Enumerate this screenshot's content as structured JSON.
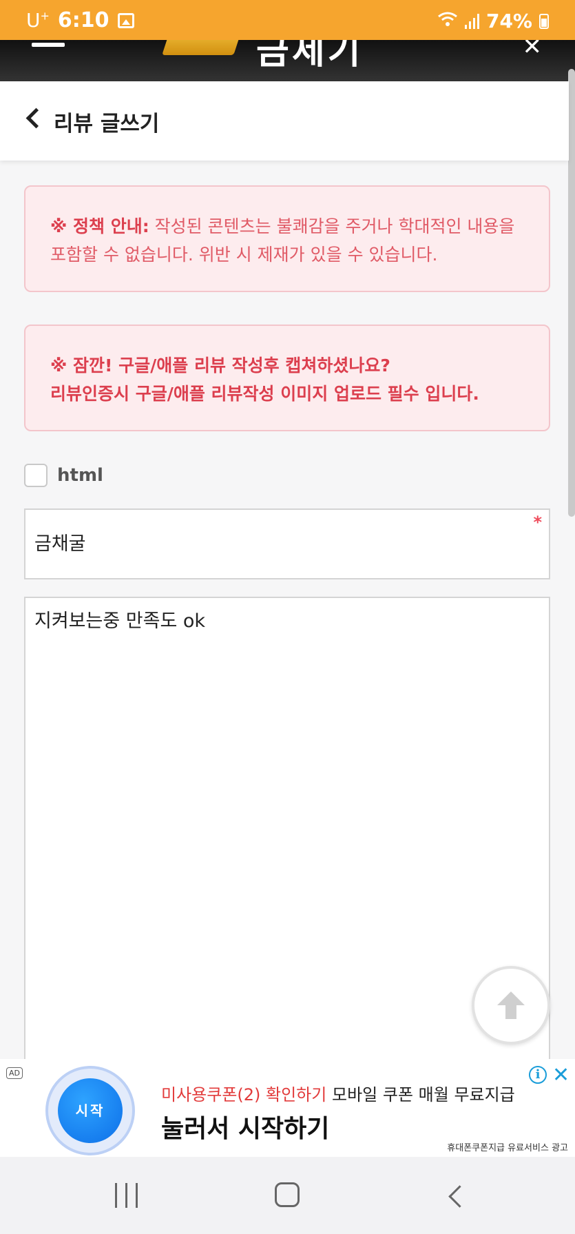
{
  "status_bar": {
    "carrier": "U",
    "carrier_sup": "+",
    "time": "6:10",
    "battery": "74%"
  },
  "header": {
    "brand": "금세기"
  },
  "page": {
    "title": "리뷰 글쓰기"
  },
  "notices": {
    "policy_label": "※ 정책 안내:",
    "policy_text": "작성된 콘텐츠는 불쾌감을 주거나 학대적인 내용을 포함할 수 없습니다. 위반 시 제재가 있을 수 있습니다.",
    "review_line1": "※ 잠깐! 구글/애플 리뷰 작성후 캡쳐하셨나요?",
    "review_line2": "리뷰인증시 구글/애플 리뷰작성 이미지 업로드 필수 입니다."
  },
  "form": {
    "html_label": "html",
    "html_checked": false,
    "subject_value": "금채굴",
    "required_mark": "*",
    "content_value": "지켜보는중 만족도 ok"
  },
  "ad": {
    "badge": "AD",
    "start_label": "시작",
    "line1_highlight": "미사용쿠폰(2) 확인하기",
    "line1_text": "모바일 쿠폰 매월 무료지급",
    "line2": "눌러서 시작하기",
    "disclaimer": "휴대폰쿠폰지급 유료서비스 광고",
    "info_icon": "i",
    "close_icon": "✕"
  },
  "colors": {
    "status_bar": "#f6a52e",
    "notice_bg": "#fdecee",
    "notice_text": "#dc3f4e",
    "ad_button": "#0d6fe8"
  },
  "icons": [
    "menu-icon",
    "close-icon",
    "back-icon",
    "arrow-up-icon",
    "info-icon",
    "nav-recent-icon",
    "nav-home-icon",
    "nav-back-icon"
  ]
}
